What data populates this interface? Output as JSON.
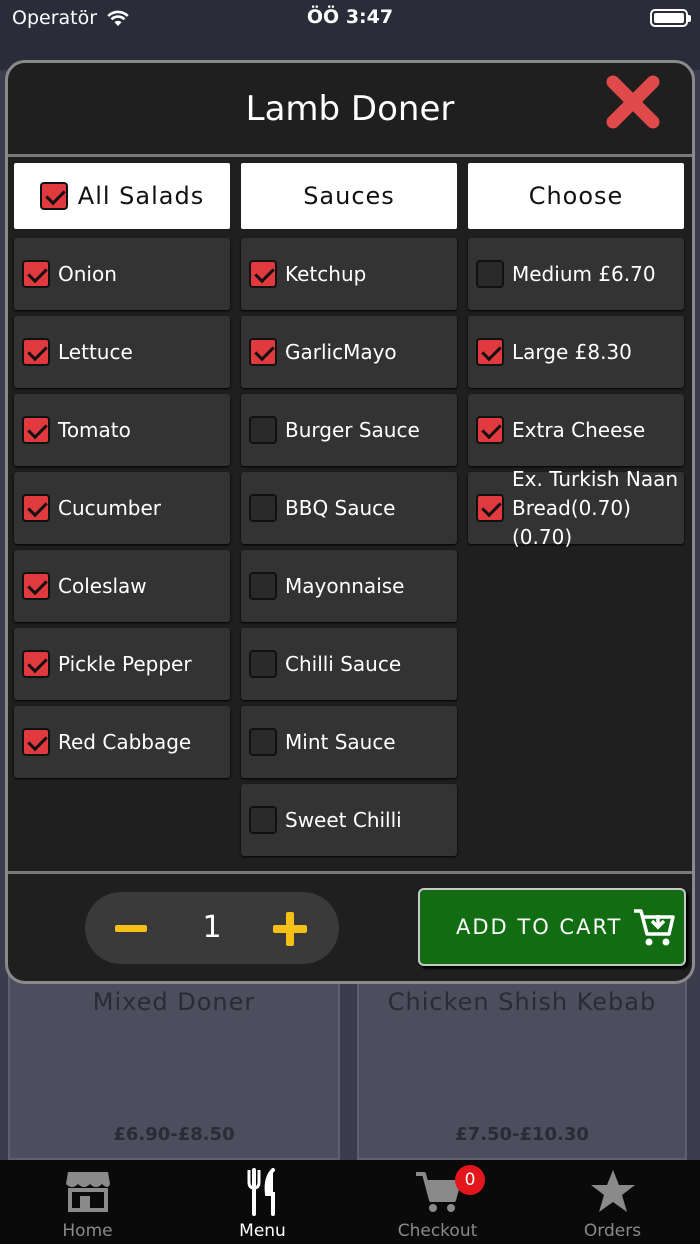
{
  "status_bar": {
    "carrier": "Operatör",
    "time": "ÖÖ 3:47"
  },
  "modal": {
    "title": "Lamb Doner"
  },
  "salads": {
    "header": "All Salads",
    "header_checked": true,
    "items": [
      {
        "label": "Onion",
        "checked": true
      },
      {
        "label": "Lettuce",
        "checked": true
      },
      {
        "label": "Tomato",
        "checked": true
      },
      {
        "label": "Cucumber",
        "checked": true
      },
      {
        "label": "Coleslaw",
        "checked": true
      },
      {
        "label": "Pickle Pepper",
        "checked": true
      },
      {
        "label": "Red Cabbage",
        "checked": true
      }
    ]
  },
  "sauces": {
    "header": "Sauces",
    "items": [
      {
        "label": "Ketchup",
        "checked": true
      },
      {
        "label": "GarlicMayo",
        "checked": true
      },
      {
        "label": "Burger Sauce",
        "checked": false
      },
      {
        "label": "BBQ Sauce",
        "checked": false
      },
      {
        "label": "Mayonnaise",
        "checked": false
      },
      {
        "label": "Chilli Sauce",
        "checked": false
      },
      {
        "label": "Mint Sauce",
        "checked": false
      },
      {
        "label": "Sweet Chilli",
        "checked": false
      }
    ]
  },
  "choose": {
    "header": "Choose",
    "items": [
      {
        "label": "Medium £6.70",
        "checked": false
      },
      {
        "label": "Large £8.30",
        "checked": true
      },
      {
        "label": "Extra Cheese",
        "checked": true
      },
      {
        "label": "Ex. Turkish Naan Bread(0.70)(0.70)",
        "checked": true
      }
    ]
  },
  "quantity": {
    "value": "1"
  },
  "add_to_cart": {
    "label": "ADD TO CART"
  },
  "background_cards": [
    {
      "name": "Mixed Doner",
      "price": "£6.90-£8.50"
    },
    {
      "name": "Chicken Shish Kebab",
      "price": "£7.50-£10.30"
    }
  ],
  "tabs": [
    {
      "label": "Home",
      "icon": "store-icon"
    },
    {
      "label": "Menu",
      "icon": "fork-knife-icon"
    },
    {
      "label": "Checkout",
      "icon": "cart-icon"
    },
    {
      "label": "Orders",
      "icon": "star-icon"
    }
  ],
  "cart_badge": "0",
  "colors": {
    "accent_red": "#e0393e",
    "accent_yellow": "#f6c017",
    "cart_green": "#116c12",
    "modal_bg": "#1f1f1f"
  }
}
